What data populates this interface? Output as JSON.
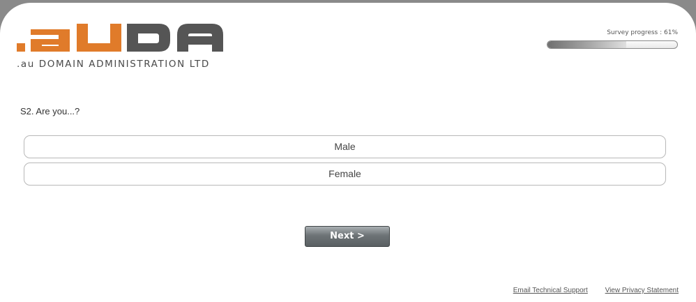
{
  "brand": {
    "logo_text": ".auDA",
    "tagline": ".au DOMAIN ADMINISTRATION LTD",
    "colors": {
      "orange": "#e07b2a",
      "gray": "#555555"
    }
  },
  "progress": {
    "label": "Survey progress : 61%",
    "percent": 61
  },
  "question": {
    "text": "S2. Are you...?",
    "options": [
      {
        "label": "Male"
      },
      {
        "label": "Female"
      }
    ]
  },
  "navigation": {
    "next_label": "Next  >"
  },
  "footer": {
    "support_link": "Email Technical Support",
    "privacy_link": "View Privacy Statement"
  }
}
